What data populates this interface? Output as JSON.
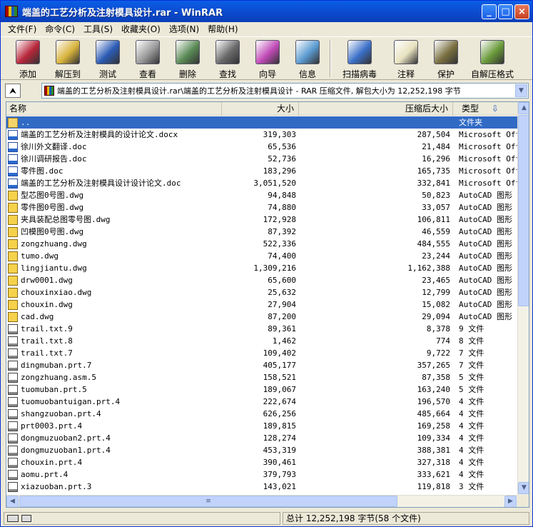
{
  "window": {
    "title": "端盖的工艺分析及注射模具设计.rar - WinRAR",
    "controls": {
      "minimize": "_",
      "maximize": "□",
      "close": "×"
    }
  },
  "menu": [
    "文件(F)",
    "命令(C)",
    "工具(S)",
    "收藏夹(O)",
    "选项(N)",
    "帮助(H)"
  ],
  "toolbar": [
    {
      "label": "添加",
      "icon": "add-archive-icon",
      "color": "#b8263a"
    },
    {
      "label": "解压到",
      "icon": "extract-to-folder-icon",
      "color": "#d8b33c"
    },
    {
      "label": "测试",
      "icon": "test-archive-icon",
      "color": "#2b5bb5"
    },
    {
      "label": "查看",
      "icon": "view-glasses-icon",
      "color": "#9a9a9a"
    },
    {
      "label": "删除",
      "icon": "delete-recycle-icon",
      "color": "#5a8a55"
    },
    {
      "label": "查找",
      "icon": "find-binoculars-icon",
      "color": "#6a6a6a"
    },
    {
      "label": "向导",
      "icon": "wizard-icon",
      "color": "#c14ab8"
    },
    {
      "label": "信息",
      "icon": "info-icon",
      "color": "#5a9ad0"
    },
    {
      "label": "扫描病毒",
      "icon": "virus-scan-icon",
      "color": "#3b70c8"
    },
    {
      "label": "注释",
      "icon": "comment-pen-icon",
      "color": "#e8e2c0"
    },
    {
      "label": "保护",
      "icon": "protect-shield-icon",
      "color": "#7a7040"
    },
    {
      "label": "自解压格式",
      "icon": "sfx-icon",
      "color": "#6a9a3a"
    }
  ],
  "address": {
    "path": "端盖的工艺分析及注射模具设计.rar\\端盖的工艺分析及注射模具设计 - RAR 压缩文件, 解包大小为 12,252,198 字节",
    "up_label": "⮝",
    "dropdown": "▼"
  },
  "columns": {
    "name": "名称",
    "size": "大小",
    "packed": "压缩后大小",
    "type": "类型",
    "sort_arrow": "⇩"
  },
  "files": [
    {
      "name": "..",
      "size": "",
      "packed": "",
      "type": "文件夹",
      "icon": "folder"
    },
    {
      "name": "端盖的工艺分析及注射模具的设计论文.docx",
      "size": "319,303",
      "packed": "287,504",
      "type": "Microsoft Office",
      "icon": "doc"
    },
    {
      "name": "徐川外文翻译.doc",
      "size": "65,536",
      "packed": "21,484",
      "type": "Microsoft Office",
      "icon": "doc"
    },
    {
      "name": "徐川调研报告.doc",
      "size": "52,736",
      "packed": "16,296",
      "type": "Microsoft Office",
      "icon": "doc"
    },
    {
      "name": "零件图.doc",
      "size": "183,296",
      "packed": "165,735",
      "type": "Microsoft Office",
      "icon": "doc"
    },
    {
      "name": "端盖的工艺分析及注射模具设计设计论文.doc",
      "size": "3,051,520",
      "packed": "332,841",
      "type": "Microsoft Office",
      "icon": "doc"
    },
    {
      "name": "型芯图0号图.dwg",
      "size": "94,848",
      "packed": "50,823",
      "type": "AutoCAD 图形",
      "icon": "dwg"
    },
    {
      "name": "零件图0号图.dwg",
      "size": "74,880",
      "packed": "33,057",
      "type": "AutoCAD 图形",
      "icon": "dwg"
    },
    {
      "name": "夹具装配总图零号图.dwg",
      "size": "172,928",
      "packed": "106,811",
      "type": "AutoCAD 图形",
      "icon": "dwg"
    },
    {
      "name": "凹模图0号图.dwg",
      "size": "87,392",
      "packed": "46,559",
      "type": "AutoCAD 图形",
      "icon": "dwg"
    },
    {
      "name": "zongzhuang.dwg",
      "size": "522,336",
      "packed": "484,555",
      "type": "AutoCAD 图形",
      "icon": "dwg"
    },
    {
      "name": "tumo.dwg",
      "size": "74,400",
      "packed": "23,244",
      "type": "AutoCAD 图形",
      "icon": "dwg"
    },
    {
      "name": "lingjiantu.dwg",
      "size": "1,309,216",
      "packed": "1,162,388",
      "type": "AutoCAD 图形",
      "icon": "dwg"
    },
    {
      "name": "drw0001.dwg",
      "size": "65,600",
      "packed": "23,465",
      "type": "AutoCAD 图形",
      "icon": "dwg"
    },
    {
      "name": "chouxinxiao.dwg",
      "size": "25,632",
      "packed": "12,799",
      "type": "AutoCAD 图形",
      "icon": "dwg"
    },
    {
      "name": "chouxin.dwg",
      "size": "27,904",
      "packed": "15,082",
      "type": "AutoCAD 图形",
      "icon": "dwg"
    },
    {
      "name": "cad.dwg",
      "size": "87,200",
      "packed": "29,094",
      "type": "AutoCAD 图形",
      "icon": "dwg"
    },
    {
      "name": "trail.txt.9",
      "size": "89,361",
      "packed": "8,378",
      "type": "9 文件",
      "icon": "txt"
    },
    {
      "name": "trail.txt.8",
      "size": "1,462",
      "packed": "774",
      "type": "8 文件",
      "icon": "txt"
    },
    {
      "name": "trail.txt.7",
      "size": "109,402",
      "packed": "9,722",
      "type": "7 文件",
      "icon": "txt"
    },
    {
      "name": "dingmuban.prt.7",
      "size": "405,177",
      "packed": "357,265",
      "type": "7 文件",
      "icon": "txt"
    },
    {
      "name": "zongzhuang.asm.5",
      "size": "158,521",
      "packed": "87,358",
      "type": "5 文件",
      "icon": "txt"
    },
    {
      "name": "tuomuban.prt.5",
      "size": "189,067",
      "packed": "163,240",
      "type": "5 文件",
      "icon": "txt"
    },
    {
      "name": "tuomuobantuigan.prt.4",
      "size": "222,674",
      "packed": "196,570",
      "type": "4 文件",
      "icon": "txt"
    },
    {
      "name": "shangzuoban.prt.4",
      "size": "626,256",
      "packed": "485,664",
      "type": "4 文件",
      "icon": "txt"
    },
    {
      "name": "prt0003.prt.4",
      "size": "189,815",
      "packed": "169,258",
      "type": "4 文件",
      "icon": "txt"
    },
    {
      "name": "dongmuzuoban2.prt.4",
      "size": "128,274",
      "packed": "109,334",
      "type": "4 文件",
      "icon": "txt"
    },
    {
      "name": "dongmuzuoban1.prt.4",
      "size": "453,319",
      "packed": "388,381",
      "type": "4 文件",
      "icon": "txt"
    },
    {
      "name": "chouxin.prt.4",
      "size": "390,461",
      "packed": "327,318",
      "type": "4 文件",
      "icon": "txt"
    },
    {
      "name": "aomu.prt.4",
      "size": "379,793",
      "packed": "333,621",
      "type": "4 文件",
      "icon": "txt"
    },
    {
      "name": "xiazuoban.prt.3",
      "size": "143,021",
      "packed": "119,818",
      "type": "3 文件",
      "icon": "txt"
    }
  ],
  "selected_index": 0,
  "scroll": {
    "up": "▲",
    "down": "▼",
    "left": "◀",
    "right": "▶",
    "grip": "≡"
  },
  "status": {
    "total": "总计 12,252,198 字节(58 个文件)"
  }
}
